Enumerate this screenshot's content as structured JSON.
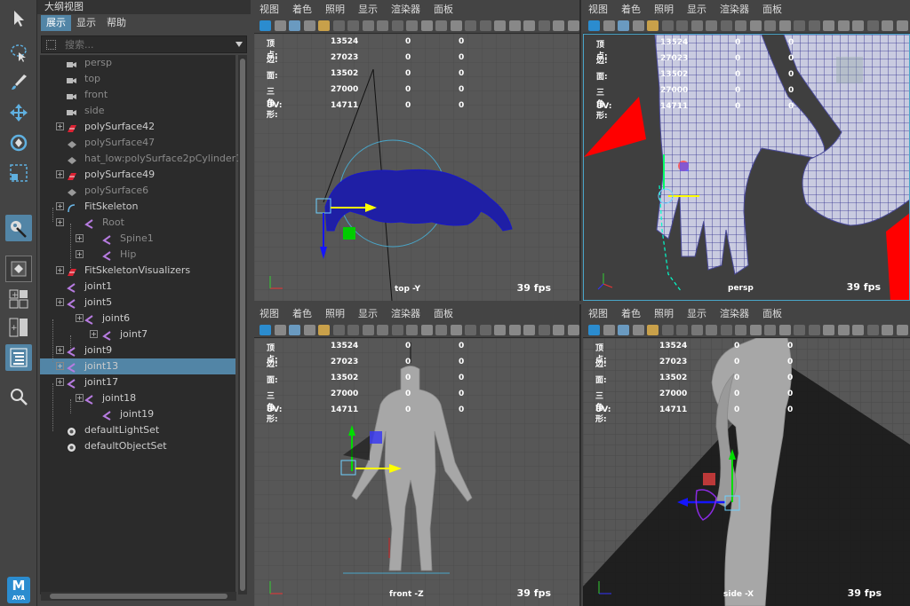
{
  "outliner": {
    "title": "大纲视图",
    "menu": [
      "展示",
      "显示",
      "帮助"
    ],
    "search_placeholder": "搜索...",
    "items": [
      {
        "label": "persp",
        "icon": "camera-icon"
      },
      {
        "label": "top",
        "icon": "camera-icon"
      },
      {
        "label": "front",
        "icon": "camera-icon"
      },
      {
        "label": "side",
        "icon": "camera-icon"
      },
      {
        "label": "polySurface42",
        "icon": "mesh-icon"
      },
      {
        "label": "polySurface47",
        "icon": "mesh-icon"
      },
      {
        "label": "hat_low:polySurface2pCylinder1",
        "icon": "mesh-icon"
      },
      {
        "label": "polySurface49",
        "icon": "mesh-icon"
      },
      {
        "label": "polySurface6",
        "icon": "mesh-icon"
      },
      {
        "label": "FitSkeleton",
        "icon": "curve-icon"
      },
      {
        "label": "Root",
        "icon": "joint-icon"
      },
      {
        "label": "Spine1",
        "icon": "joint-icon"
      },
      {
        "label": "Hip",
        "icon": "joint-icon"
      },
      {
        "label": "FitSkeletonVisualizers",
        "icon": "mesh-icon"
      },
      {
        "label": "joint1",
        "icon": "joint-icon"
      },
      {
        "label": "joint5",
        "icon": "joint-icon"
      },
      {
        "label": "joint6",
        "icon": "joint-icon"
      },
      {
        "label": "joint7",
        "icon": "joint-icon"
      },
      {
        "label": "joint9",
        "icon": "joint-icon"
      },
      {
        "label": "joint13",
        "icon": "joint-icon"
      },
      {
        "label": "joint17",
        "icon": "joint-icon"
      },
      {
        "label": "joint18",
        "icon": "joint-icon"
      },
      {
        "label": "joint19",
        "icon": "joint-icon"
      },
      {
        "label": "defaultLightSet",
        "icon": "set-icon"
      },
      {
        "label": "defaultObjectSet",
        "icon": "set-icon"
      }
    ]
  },
  "viewport_menu": [
    "视图",
    "着色",
    "照明",
    "显示",
    "渲染器",
    "面板"
  ],
  "hud": {
    "labels": [
      "顶点:",
      "边:",
      "面:",
      "三角形:",
      "UV:"
    ],
    "values": [
      "13524",
      "27023",
      "13502",
      "27000",
      "14711"
    ],
    "zero": "0"
  },
  "viewports": {
    "top": {
      "camera": "top -Y",
      "fps": "39 fps"
    },
    "persp": {
      "camera": "persp",
      "fps": "39 fps"
    },
    "front": {
      "camera": "front -Z",
      "fps": "39 fps"
    },
    "side": {
      "camera": "side -X",
      "fps": "39 fps"
    }
  },
  "app_badge": {
    "letter": "M",
    "text": "AYA"
  },
  "colors": {
    "selection": "#5285a6",
    "mesh_wire": "#1a1aa0",
    "gizmo_yellow": "#ffff00"
  }
}
